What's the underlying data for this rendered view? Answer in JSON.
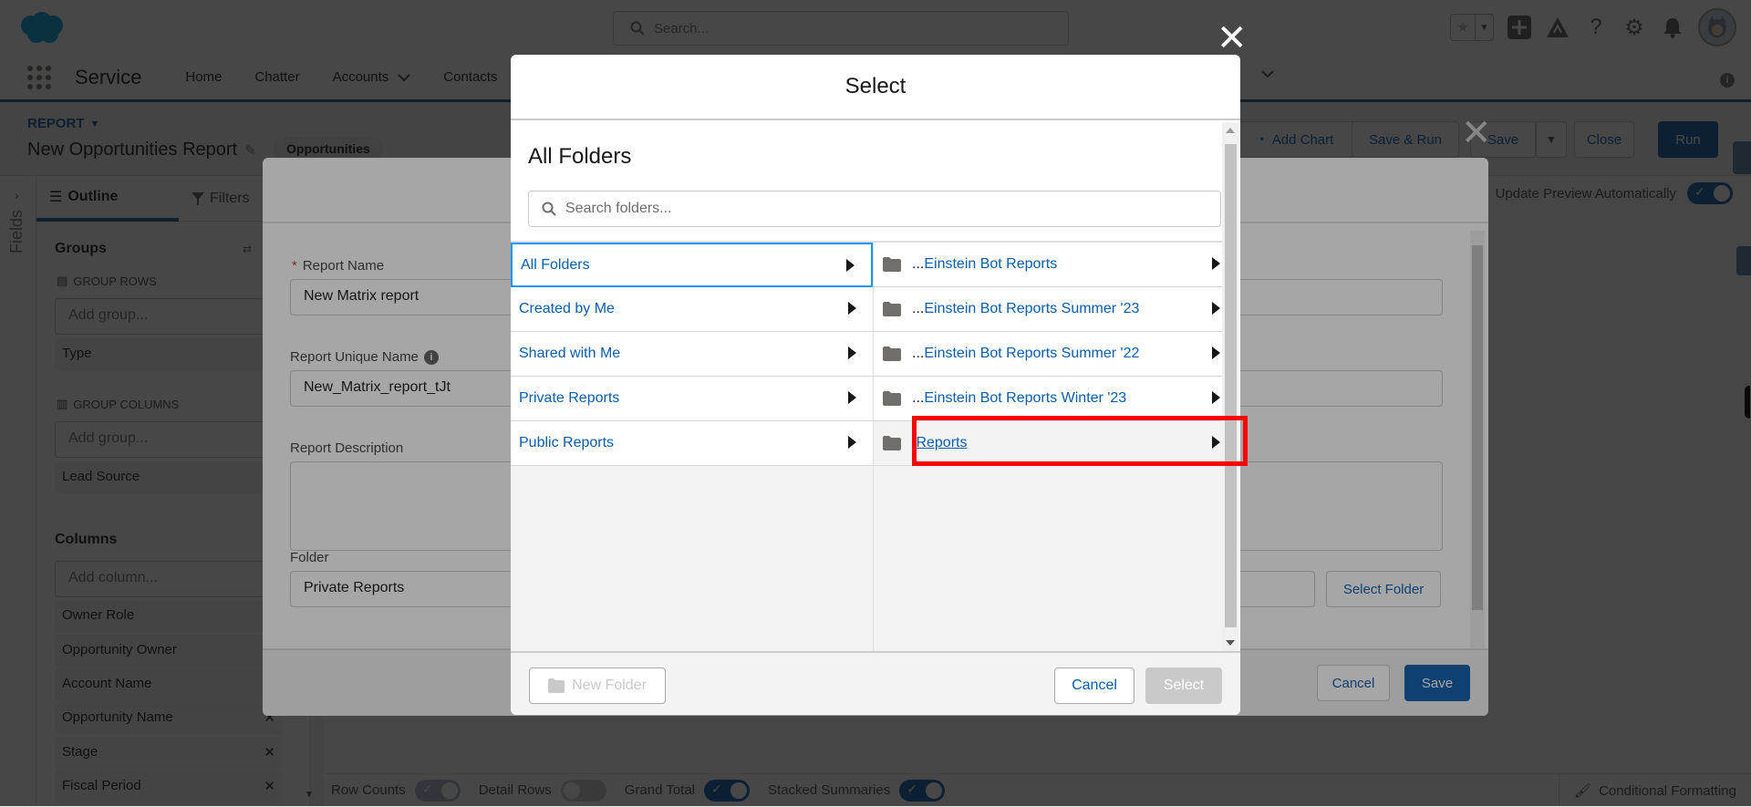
{
  "topbar": {
    "search_placeholder": "Search...",
    "icons": [
      "favorites-star-icon",
      "favorites-dropdown-icon",
      "global-actions-plus-icon",
      "trailhead-icon",
      "help-icon",
      "setup-gear-icon",
      "notifications-bell-icon",
      "user-avatar"
    ]
  },
  "nav": {
    "app_name": "Service",
    "items": [
      {
        "label": "Home",
        "has_dropdown": false
      },
      {
        "label": "Chatter",
        "has_dropdown": false
      },
      {
        "label": "Accounts",
        "has_dropdown": true
      },
      {
        "label": "Contacts",
        "has_dropdown": false
      }
    ]
  },
  "report_header": {
    "type_label": "REPORT",
    "title": "New Opportunities Report",
    "report_type_pill": "Opportunities",
    "buttons": {
      "add_chart": "Add Chart",
      "save_run": "Save & Run",
      "save": "Save",
      "close": "Close",
      "run": "Run"
    }
  },
  "left_panel": {
    "fields_label": "Fields",
    "tabs": {
      "outline": "Outline",
      "filters": "Filters"
    },
    "groups_title": "Groups",
    "group_rows_label": "GROUP ROWS",
    "group_rows_placeholder": "Add group...",
    "group_rows": [
      "Type"
    ],
    "group_columns_label": "GROUP COLUMNS",
    "group_columns_placeholder": "Add group...",
    "group_columns": [
      "Lead Source"
    ],
    "columns_title": "Columns",
    "columns_placeholder": "Add column...",
    "columns": [
      "Owner Role",
      "Opportunity Owner",
      "Account Name",
      "Opportunity Name",
      "Stage",
      "Fiscal Period"
    ]
  },
  "preview": {
    "update_preview_label": "Update Preview Automatically",
    "update_preview_on": true,
    "footer": {
      "row_counts": {
        "label": "Row Counts",
        "on": true
      },
      "detail_rows": {
        "label": "Detail Rows",
        "on": false
      },
      "grand_total": {
        "label": "Grand Total",
        "on": true
      },
      "stacked_summaries": {
        "label": "Stacked Summaries",
        "on": true
      },
      "conditional_formatting": "Conditional Formatting"
    }
  },
  "save_modal": {
    "report_name_label": "Report Name",
    "report_name_value": "New Matrix report",
    "unique_name_label": "Report Unique Name",
    "unique_name_value": "New_Matrix_report_tJt",
    "description_label": "Report Description",
    "description_value": "",
    "folder_label": "Folder",
    "folder_value": "Private Reports",
    "select_folder_button": "Select Folder",
    "cancel_button": "Cancel",
    "save_button": "Save"
  },
  "select_modal": {
    "title": "Select",
    "breadcrumb_title": "All Folders",
    "search_placeholder": "Search folders...",
    "left_column": [
      {
        "label": "All Folders",
        "selected": true
      },
      {
        "label": "Created by Me",
        "selected": false
      },
      {
        "label": "Shared with Me",
        "selected": false
      },
      {
        "label": "Private Reports",
        "selected": false
      },
      {
        "label": "Public Reports",
        "selected": false
      }
    ],
    "right_column": [
      {
        "prefix": "...",
        "label": "Einstein Bot Reports"
      },
      {
        "prefix": "...",
        "label": "Einstein Bot Reports Summer '23"
      },
      {
        "prefix": "...",
        "label": "Einstein Bot Reports Summer '22"
      },
      {
        "prefix": "...",
        "label": "Einstein Bot Reports Winter '23"
      },
      {
        "prefix": ".",
        "label": "Reports",
        "hovered": true
      }
    ],
    "new_folder_button": "New Folder",
    "cancel_button": "Cancel",
    "select_button": "Select",
    "select_button_disabled": true
  },
  "colors": {
    "brand": "#0b5cab",
    "link": "#0b5cab",
    "nav_accent": "#1b5297",
    "highlight": "#ff0000",
    "selected_border": "#1b96ff"
  }
}
